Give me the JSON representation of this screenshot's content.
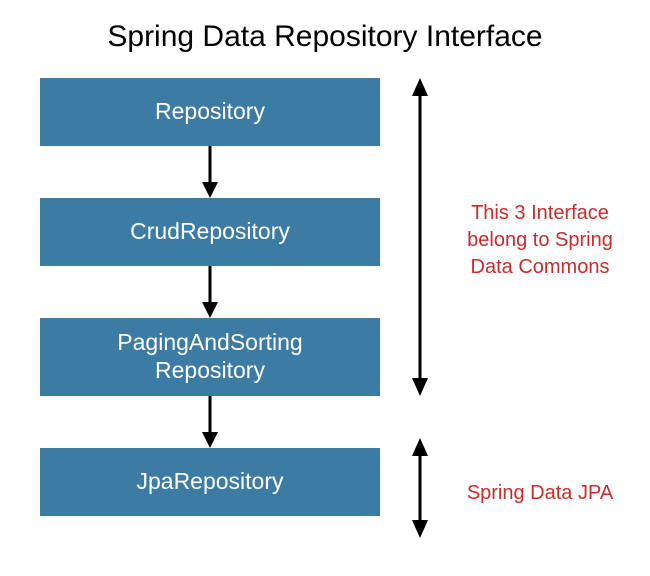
{
  "title": "Spring Data Repository Interface",
  "boxes": [
    {
      "label": "Repository"
    },
    {
      "label": "CrudRepository"
    },
    {
      "label": "PagingAndSorting Repository"
    },
    {
      "label": "JpaRepository"
    }
  ],
  "annotations": {
    "commons": "This 3 Interface belong to Spring Data Commons",
    "jpa": "Spring Data JPA"
  }
}
